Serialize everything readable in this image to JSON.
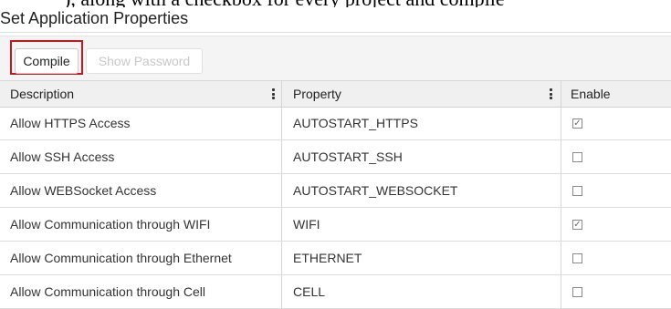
{
  "panel": {
    "title": "Set Application Properties"
  },
  "toolbar": {
    "compile_label": "Compile",
    "show_password_label": "Show Password"
  },
  "columns": {
    "description": "Description",
    "property": "Property",
    "enable": "Enable"
  },
  "rows": [
    {
      "description": "Allow HTTPS Access",
      "property": "AUTOSTART_HTTPS",
      "enabled": true
    },
    {
      "description": "Allow SSH Access",
      "property": "AUTOSTART_SSH",
      "enabled": false
    },
    {
      "description": "Allow WEBSocket Access",
      "property": "AUTOSTART_WEBSOCKET",
      "enabled": false
    },
    {
      "description": "Allow Communication through WIFI",
      "property": "WIFI",
      "enabled": true
    },
    {
      "description": "Allow Communication through Ethernet",
      "property": "ETHERNET",
      "enabled": false
    },
    {
      "description": "Allow Communication through Cell",
      "property": "CELL",
      "enabled": false
    }
  ]
}
